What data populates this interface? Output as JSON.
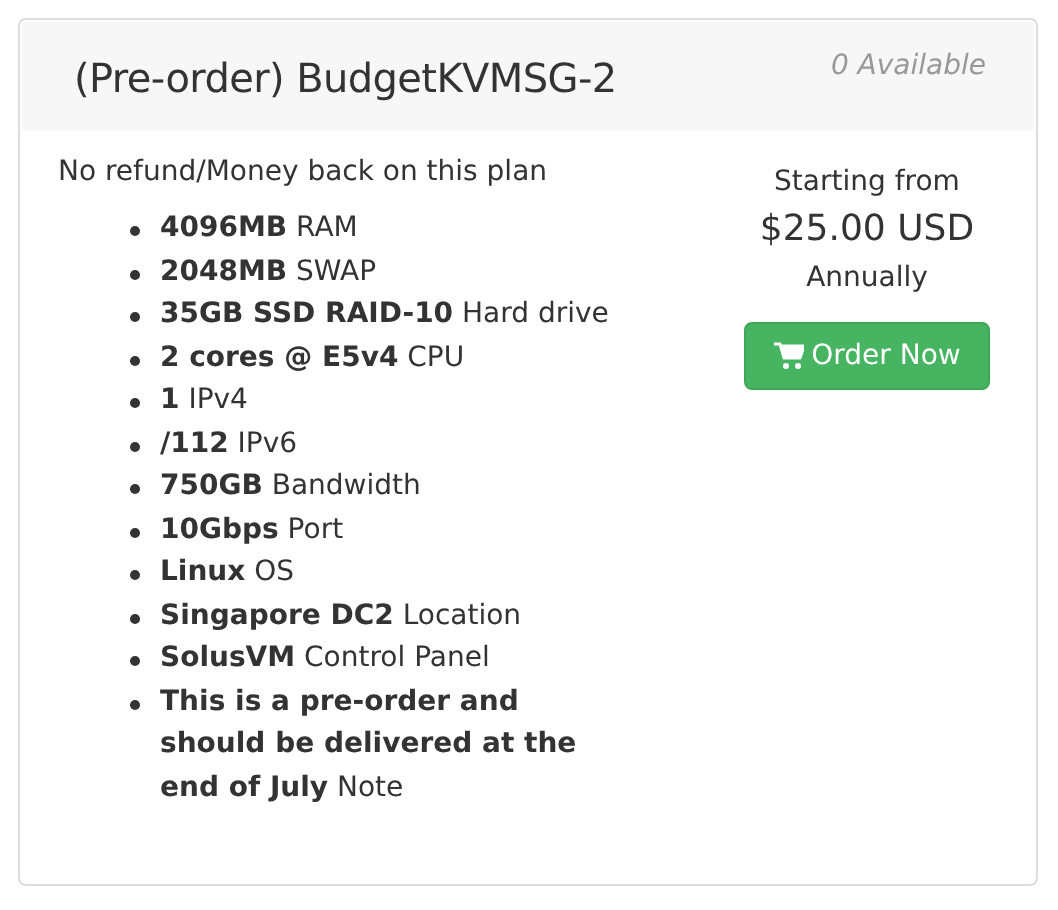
{
  "card": {
    "title": "(Pre-order) BudgetKVMSG-2",
    "availability": "0 Available"
  },
  "note": "No refund/Money back on this plan",
  "features": [
    "**4096MB** RAM",
    "**2048MB** SWAP",
    "**35GB SSD RAID-10** Hard drive",
    "**2 cores @ E5v4** CPU",
    "**1** IPv4",
    "**/112** IPv6",
    "**750GB** Bandwidth",
    "**10Gbps** Port",
    "**Linux** OS",
    "**Singapore DC2** Location",
    "**SolusVM** Control Panel",
    "**This is a pre-order and should be delivered at the end of July** Note"
  ],
  "pricing": {
    "prefix": "Starting from",
    "price": "$25.00 USD",
    "cycle": "Annually"
  },
  "order_button": "Order Now"
}
